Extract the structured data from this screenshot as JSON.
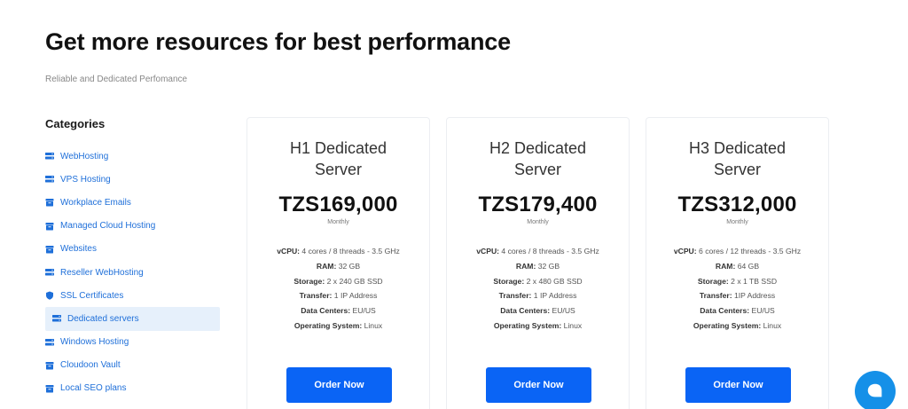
{
  "header": {
    "title": "Get more resources for best performance",
    "subtitle": "Reliable and Dedicated Perfomance"
  },
  "sidebar": {
    "title": "Categories",
    "items": [
      {
        "label": "WebHosting",
        "icon": "server-icon",
        "active": false
      },
      {
        "label": "VPS Hosting",
        "icon": "server-icon",
        "active": false
      },
      {
        "label": "Workplace Emails",
        "icon": "archive-icon",
        "active": false
      },
      {
        "label": "Managed Cloud Hosting",
        "icon": "archive-icon",
        "active": false
      },
      {
        "label": "Websites",
        "icon": "archive-icon",
        "active": false
      },
      {
        "label": "Reseller WebHosting",
        "icon": "server-icon",
        "active": false
      },
      {
        "label": "SSL Certificates",
        "icon": "shield-icon",
        "active": false
      },
      {
        "label": "Dedicated servers",
        "icon": "server-icon",
        "active": true
      },
      {
        "label": "Windows Hosting",
        "icon": "server-icon",
        "active": false
      },
      {
        "label": "Cloudoon Vault",
        "icon": "archive-icon",
        "active": false
      },
      {
        "label": "Local SEO plans",
        "icon": "archive-icon",
        "active": false
      }
    ]
  },
  "plans": [
    {
      "name": "H1 Dedicated Server",
      "price": "TZS169,000",
      "period": "Monthly",
      "specs": {
        "vcpu_key": "vCPU:",
        "vcpu": " 4 cores / 8 threads - 3.5 GHz",
        "ram_key": "RAM:",
        "ram": " 32 GB",
        "storage_key": "Storage:",
        "storage": " 2 x 240 GB SSD",
        "transfer_key": "Transfer:",
        "transfer": " 1 IP Address",
        "dc_key": "Data Centers:",
        "dc": " EU/US",
        "os_key": "Operating System:",
        "os": " Linux"
      },
      "button": "Order Now"
    },
    {
      "name": "H2 Dedicated Server",
      "price": "TZS179,400",
      "period": "Monthly",
      "specs": {
        "vcpu_key": "vCPU:",
        "vcpu": " 4 cores / 8 threads - 3.5 GHz",
        "ram_key": "RAM:",
        "ram": " 32 GB",
        "storage_key": "Storage:",
        "storage": " 2 x 480 GB SSD",
        "transfer_key": "Transfer:",
        "transfer": " 1 IP Address",
        "dc_key": "Data Centers:",
        "dc": " EU/US",
        "os_key": "Operating System:",
        "os": " Linux"
      },
      "button": "Order Now"
    },
    {
      "name": "H3 Dedicated Server",
      "price": "TZS312,000",
      "period": "Monthly",
      "specs": {
        "vcpu_key": "vCPU:",
        "vcpu": " 6 cores / 12 threads - 3.5 GHz",
        "ram_key": "RAM:",
        "ram": " 64 GB",
        "storage_key": "Storage:",
        "storage": " 2 x 1 TB SSD",
        "transfer_key": "Transfer:",
        "transfer": " 1IP Address",
        "dc_key": "Data Centers:",
        "dc": " EU/US",
        "os_key": "Operating System:",
        "os": " Linux"
      },
      "button": "Order Now"
    }
  ],
  "chat": {
    "icon": "chat-icon"
  },
  "colors": {
    "accent": "#0a64f5",
    "link": "#1e6fd9",
    "active_bg": "#e6f0fb",
    "chat": "#1590e8"
  }
}
